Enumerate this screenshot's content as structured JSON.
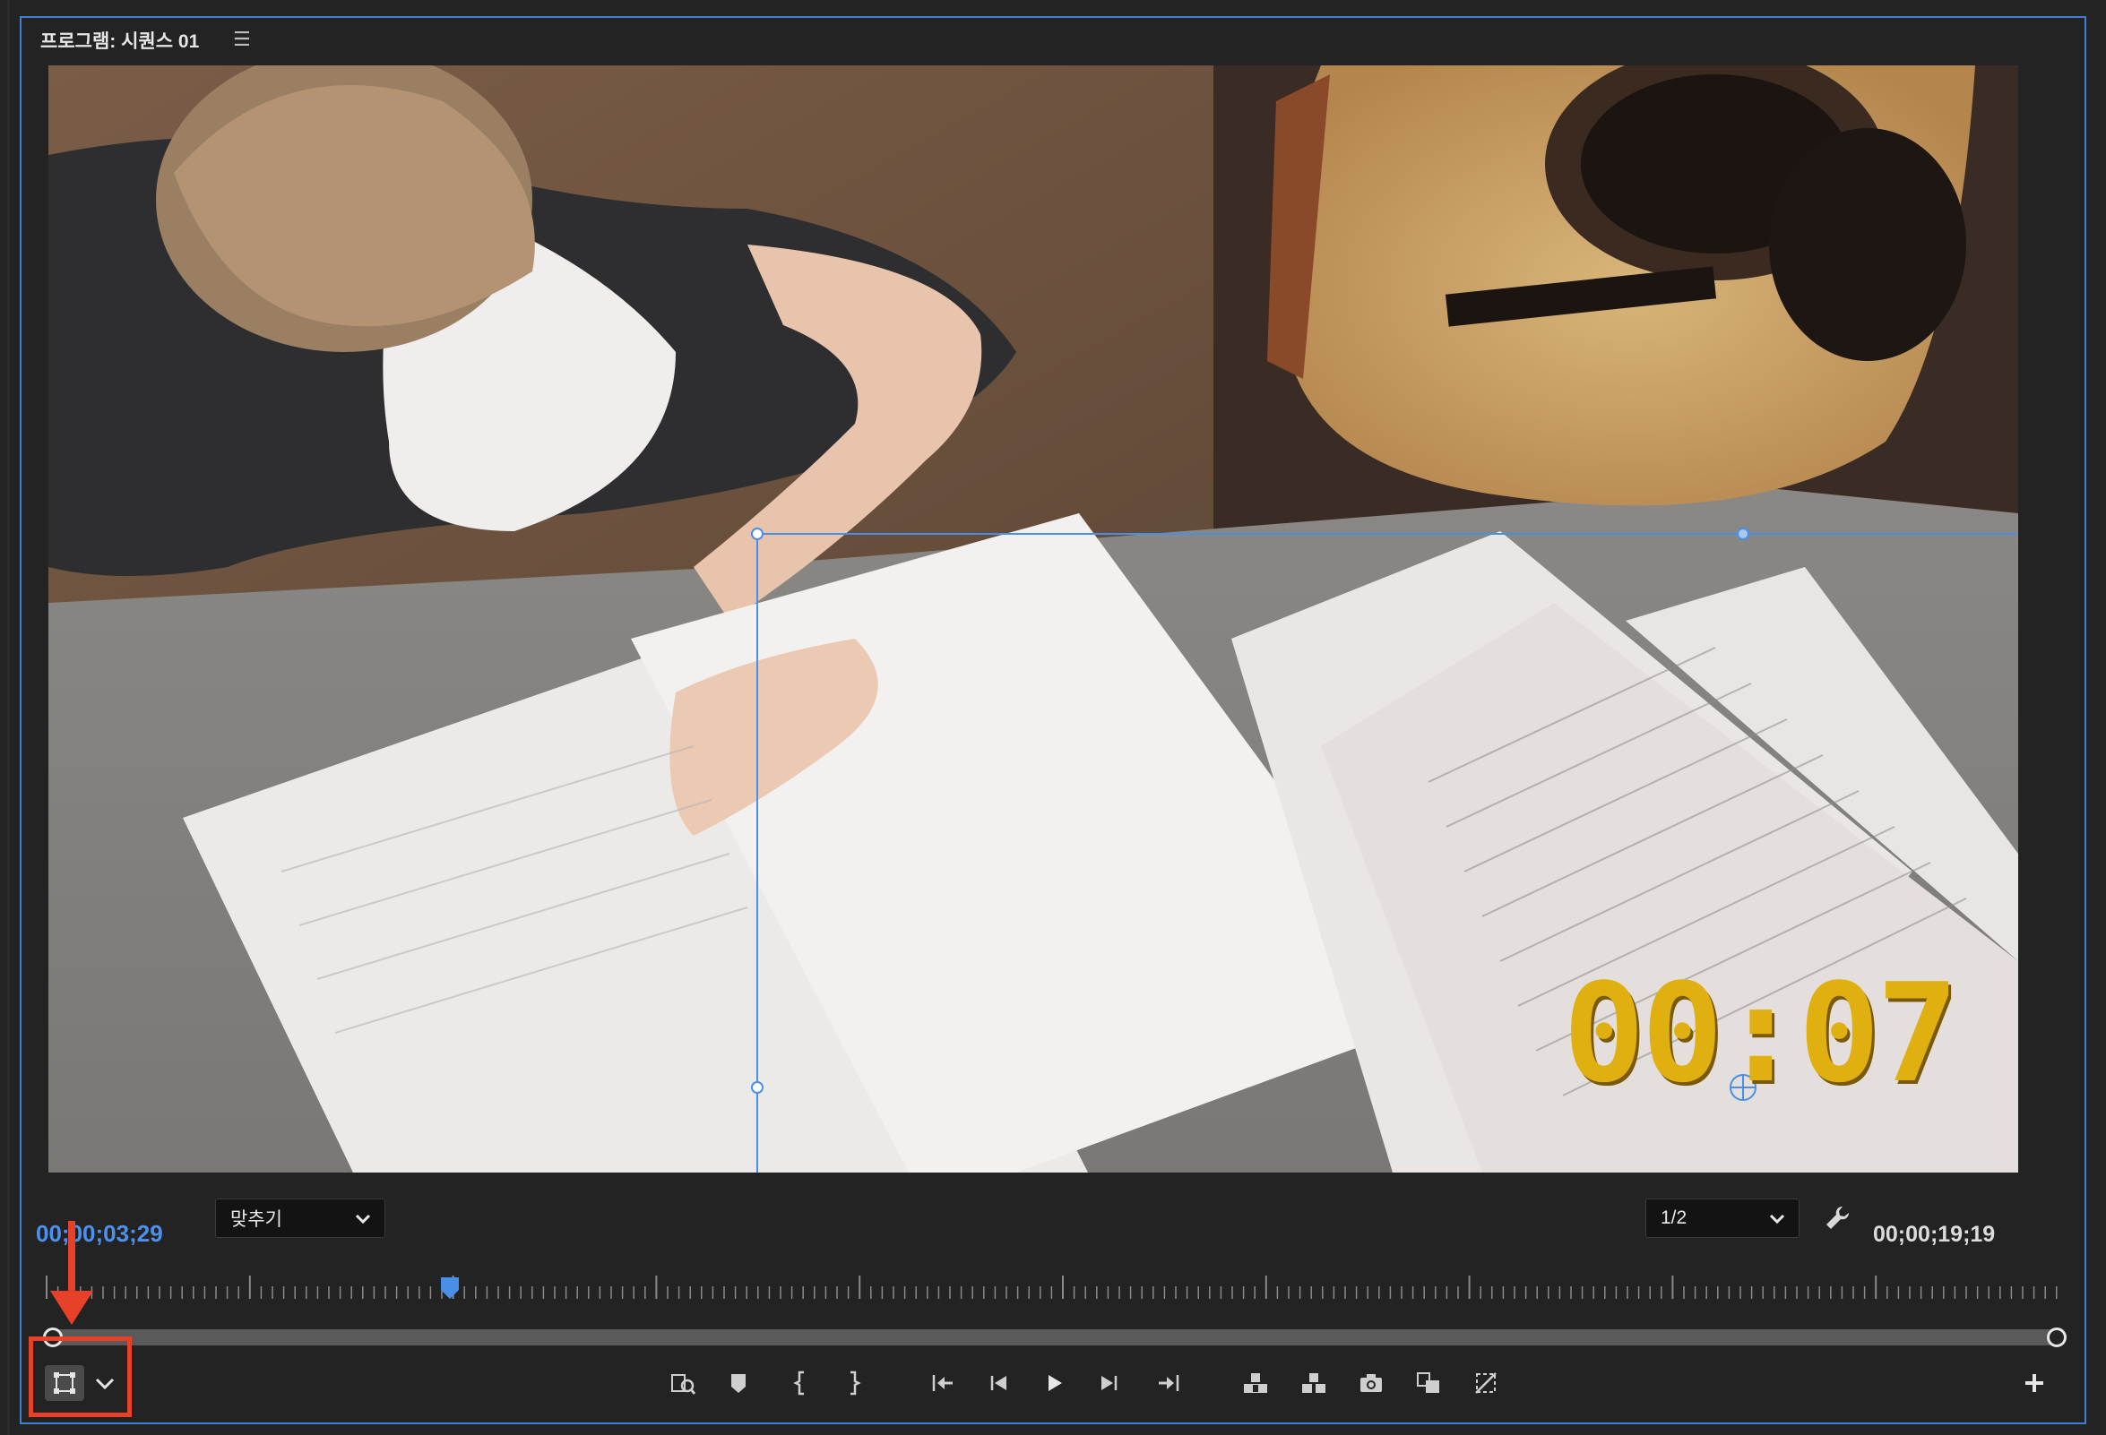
{
  "panel": {
    "title": "프로그램: 시퀀스 01",
    "menu_icon": "hamburger-menu-icon"
  },
  "viewer": {
    "overlay_text": "00:07",
    "overlay_color": "#e0b010",
    "guide_color": "#4a8fe7"
  },
  "timecode": {
    "current": "00;00;03;29",
    "duration": "00;00;19;19",
    "current_color": "#4d90ee"
  },
  "zoom_dropdown": {
    "value": "맞추기"
  },
  "resolution_dropdown": {
    "value": "1/2"
  },
  "playhead_color": "#4a8fe7",
  "annotation_color": "#e8412a",
  "controls": {
    "left": [
      "transform-icon",
      "chevron-down-icon"
    ],
    "center": [
      "insert-frame-icon",
      "add-marker-icon",
      "mark-in-icon",
      "mark-out-icon",
      "go-to-in-icon",
      "step-back-icon",
      "play-icon",
      "step-forward-icon",
      "go-to-out-icon",
      "lift-icon",
      "extract-icon",
      "export-frame-icon",
      "comparison-view-icon",
      "safe-margins-icon"
    ],
    "right": [
      "add-button-icon"
    ]
  }
}
